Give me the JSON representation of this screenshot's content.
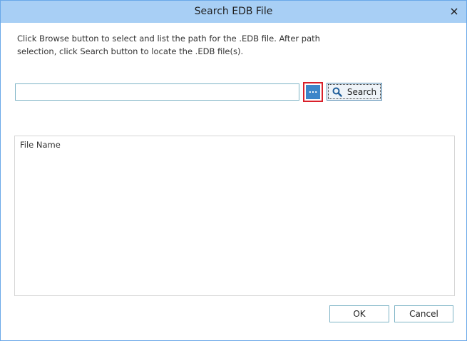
{
  "window": {
    "title": "Search EDB File",
    "close_symbol": "×"
  },
  "instructions": {
    "line1": "Click Browse button to select and list the path for the .EDB file. After path",
    "line2": "selection, click Search button to locate the .EDB file(s)."
  },
  "path_input": {
    "value": "",
    "placeholder": ""
  },
  "browse_button": {
    "label": "..."
  },
  "search_button": {
    "label": "Search",
    "icon": "magnifier-icon"
  },
  "file_list": {
    "column_header": "File Name",
    "rows": []
  },
  "footer": {
    "ok_label": "OK",
    "cancel_label": "Cancel"
  },
  "colors": {
    "titlebar": "#a8cff5",
    "window_border": "#6aa8e8",
    "browse_fill": "#3d86c9",
    "highlight": "#d9202a",
    "search_icon": "#1f5d99"
  }
}
